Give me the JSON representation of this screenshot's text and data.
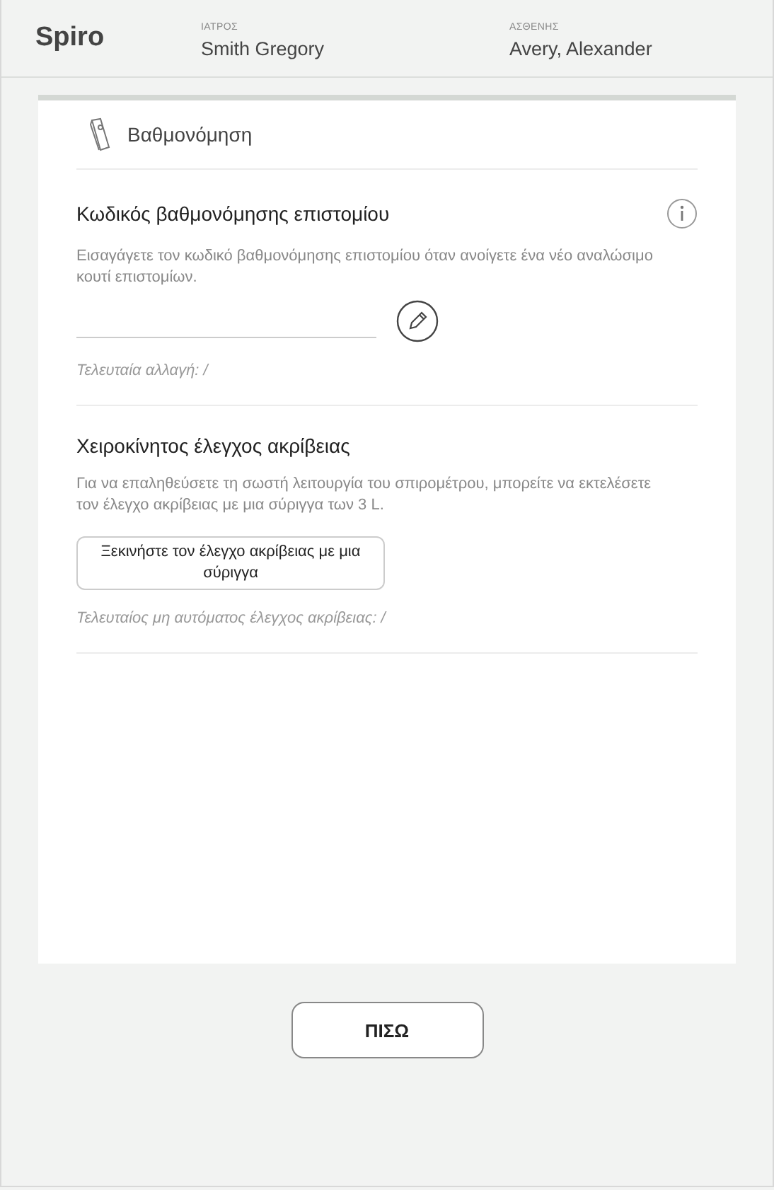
{
  "header": {
    "app_name": "Spiro",
    "doctor": {
      "label": "ΙΑΤΡΟΣ",
      "name": "Smith Gregory"
    },
    "patient": {
      "label": "ΑΣΘΕΝΗΣ",
      "name": "Avery, Alexander"
    }
  },
  "panel": {
    "title": "Βαθμονόμηση",
    "sections": [
      {
        "kind": "code",
        "title": "Κωδικός βαθμονόμησης επιστομίου",
        "description": "Εισαγάγετε τον κωδικό βαθμονόμησης επιστομίου όταν ανοίγετε ένα νέο αναλώσιμο κουτί επιστομίων.",
        "note": "Τελευταία αλλαγή: /"
      },
      {
        "kind": "check",
        "title": "Χειροκίνητος έλεγχος ακρίβειας",
        "description": "Για να επαληθεύσετε τη σωστή λειτουργία του σπιρομέτρου, μπορείτε να εκτελέσετε τον έλεγχο ακρίβειας με μια σύριγγα των 3 L.",
        "button": "Ξεκινήστε τον έλεγχο ακρίβειας με μια σύριγγα",
        "note": "Τελευταίος μη αυτόματος έλεγχος ακρίβειας: /"
      }
    ]
  },
  "back_button": "ΠΙΣΩ"
}
